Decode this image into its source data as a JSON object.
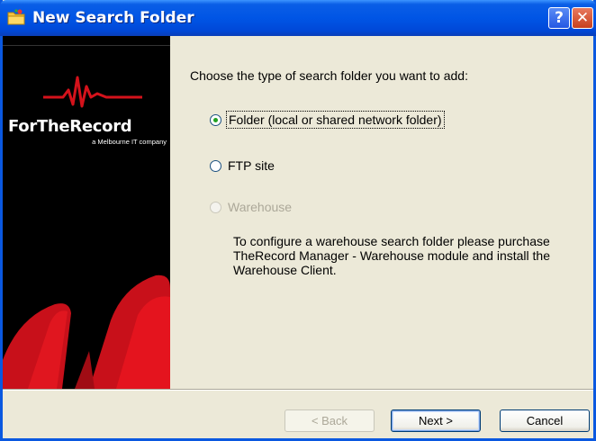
{
  "window": {
    "title": "New Search Folder"
  },
  "titlebar": {
    "help_label": "?",
    "close_label": "✕"
  },
  "sidebar": {
    "brand_name": "ForTheRecord",
    "brand_sub": "a Melbourne IT company"
  },
  "content": {
    "prompt": "Choose the type of search folder you want to add:",
    "options": [
      {
        "label": "Folder (local or shared network folder)",
        "selected": true,
        "enabled": true
      },
      {
        "label": "FTP site",
        "selected": false,
        "enabled": true
      },
      {
        "label": "Warehouse",
        "selected": false,
        "enabled": false
      }
    ],
    "note": "To configure a warehouse search folder please purchase  TheRecord Manager - Warehouse module and install the Warehouse Client."
  },
  "buttons": {
    "back_label": "< Back",
    "next_label": "Next >",
    "cancel_label": "Cancel"
  },
  "colors": {
    "titlebar": "#0055e5",
    "radio_selected": "#21a121",
    "disabled_text": "#aca899",
    "brand_red": "#d4121b"
  }
}
